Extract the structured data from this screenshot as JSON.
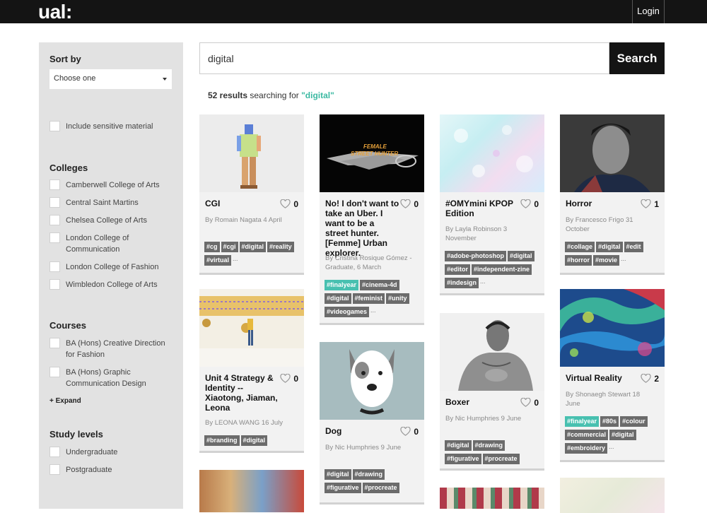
{
  "header": {
    "logo": "ual:",
    "login": "Login"
  },
  "sidebar": {
    "sort_heading": "Sort by",
    "sort_value": "Choose one",
    "sensitive_label": "Include sensitive material",
    "colleges_heading": "Colleges",
    "colleges": [
      "Camberwell College of Arts",
      "Central Saint Martins",
      "Chelsea College of Arts",
      "London College of Communication",
      "London College of Fashion",
      "Wimbledon College of Arts"
    ],
    "courses_heading": "Courses",
    "courses": [
      "BA (Hons) Creative Direction for Fashion",
      "BA (Hons) Graphic Communication Design"
    ],
    "expand": "+ Expand",
    "levels_heading": "Study levels",
    "levels": [
      "Undergraduate",
      "Postgraduate"
    ]
  },
  "search": {
    "query": "digital",
    "button": "Search"
  },
  "results": {
    "count": "52 results",
    "text": " searching for ",
    "query": "\"digital\""
  },
  "cards": [
    {
      "title": "CGI",
      "likes": "0",
      "meta": "By Romain Nagata 4 April",
      "tags": [
        "#cg",
        "#cgi",
        "#digital",
        "#reality",
        "#virtual"
      ],
      "highlight": [],
      "more": "..."
    },
    {
      "title": "No! I don't want to take an Uber. I want to be a street hunter. [Femme] Urban explorer.",
      "likes": "0",
      "meta": "By Cristina Rosique Gómez - Graduate, 6 March",
      "tags": [
        "#finalyear",
        "#cinema-4d",
        "#digital",
        "#feminist",
        "#unity",
        "#videogames"
      ],
      "highlight": [
        "#finalyear"
      ],
      "more": "..."
    },
    {
      "title": "#OMYmini KPOP Edition",
      "likes": "0",
      "meta": "By Layla Robinson 3 November",
      "tags": [
        "#adobe-photoshop",
        "#digital",
        "#editor",
        "#independent-zine",
        "#indesign"
      ],
      "highlight": [],
      "more": "..."
    },
    {
      "title": "Horror",
      "likes": "1",
      "meta": "By Francesco Frigo 31 October",
      "tags": [
        "#collage",
        "#digital",
        "#edit",
        "#horror",
        "#movie"
      ],
      "highlight": [],
      "more": "..."
    },
    {
      "title": "Unit 4 Strategy & Identity -- Xiaotong, Jiaman, Leona",
      "likes": "0",
      "meta": "By LEONA WANG 16 July",
      "tags": [
        "#branding",
        "#digital"
      ],
      "highlight": [],
      "more": ""
    },
    {
      "title": "Dog",
      "likes": "0",
      "meta": "By Nic Humphries 9 June",
      "tags": [
        "#digital",
        "#drawing",
        "#figurative",
        "#procreate"
      ],
      "highlight": [],
      "more": ""
    },
    {
      "title": "Boxer",
      "likes": "0",
      "meta": "By Nic Humphries 9 June",
      "tags": [
        "#digital",
        "#drawing",
        "#figurative",
        "#procreate"
      ],
      "highlight": [],
      "more": ""
    },
    {
      "title": "Virtual Reality",
      "likes": "2",
      "meta": "By Shonaegh Stewart 18 June",
      "tags": [
        "#finalyear",
        "#80s",
        "#colour",
        "#commercial",
        "#digital",
        "#embroidery"
      ],
      "highlight": [
        "#finalyear"
      ],
      "more": "..."
    }
  ],
  "colors": {
    "accent": "#3bb9a2",
    "tag_bg": "#6b6b6b",
    "tag_highlight": "#48c0b0",
    "topbar": "#141414"
  }
}
